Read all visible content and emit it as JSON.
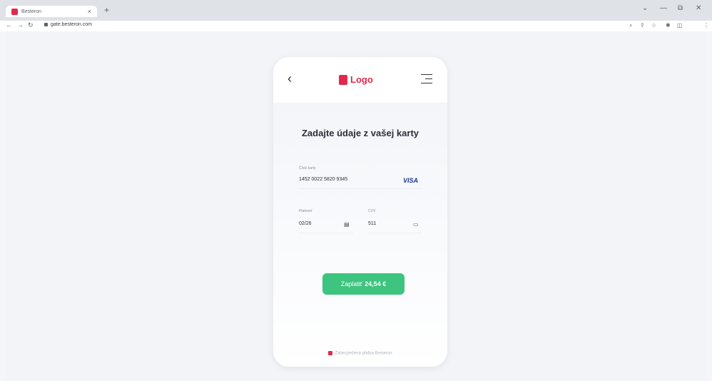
{
  "browser": {
    "tab_title": "Besteron",
    "tab_close": "×",
    "new_tab": "+",
    "url": "gate.besteron.com",
    "win_min": "—",
    "win_max": "⧉",
    "win_close": "✕",
    "caret": "⌄"
  },
  "page": {
    "logo_text": "Logo",
    "back_glyph": "‹",
    "title": "Zadajte údaje z vašej karty",
    "card_label": "Číslo karty",
    "card_number": "1452 0022 5820 9345",
    "card_brand": "VISA",
    "expiry_label": "Platnosť",
    "expiry_value": "02/26",
    "cvv_label": "CVV",
    "cvv_value": "511",
    "pay_label": "Zaplatiť",
    "pay_amount": "24,54 €",
    "footer": "Zabezpečená platba Besteron"
  },
  "colors": {
    "brand": "#e1294b",
    "button": "#3dc47e",
    "visa": "#1a3a8f"
  },
  "icons": [
    "back-icon",
    "menu-icon",
    "calendar-icon",
    "card-icon",
    "lock-icon",
    "reload-icon"
  ]
}
